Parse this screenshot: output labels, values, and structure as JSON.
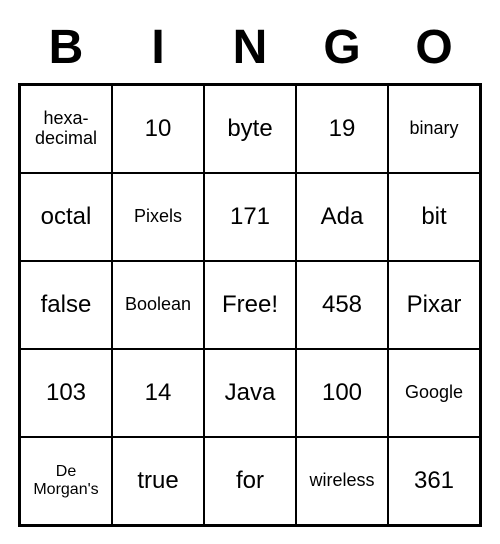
{
  "header": [
    "B",
    "I",
    "N",
    "G",
    "O"
  ],
  "cells": [
    [
      {
        "text": "hexa-\ndecimal",
        "size": "small"
      },
      {
        "text": "10",
        "size": ""
      },
      {
        "text": "byte",
        "size": ""
      },
      {
        "text": "19",
        "size": ""
      },
      {
        "text": "binary",
        "size": "small"
      }
    ],
    [
      {
        "text": "octal",
        "size": ""
      },
      {
        "text": "Pixels",
        "size": "small"
      },
      {
        "text": "171",
        "size": ""
      },
      {
        "text": "Ada",
        "size": ""
      },
      {
        "text": "bit",
        "size": ""
      }
    ],
    [
      {
        "text": "false",
        "size": ""
      },
      {
        "text": "Boolean",
        "size": "small"
      },
      {
        "text": "Free!",
        "size": ""
      },
      {
        "text": "458",
        "size": ""
      },
      {
        "text": "Pixar",
        "size": ""
      }
    ],
    [
      {
        "text": "103",
        "size": ""
      },
      {
        "text": "14",
        "size": ""
      },
      {
        "text": "Java",
        "size": ""
      },
      {
        "text": "100",
        "size": ""
      },
      {
        "text": "Google",
        "size": "small"
      }
    ],
    [
      {
        "text": "De\nMorgan's",
        "size": "xsmall"
      },
      {
        "text": "true",
        "size": ""
      },
      {
        "text": "for",
        "size": ""
      },
      {
        "text": "wireless",
        "size": "small"
      },
      {
        "text": "361",
        "size": ""
      }
    ]
  ]
}
